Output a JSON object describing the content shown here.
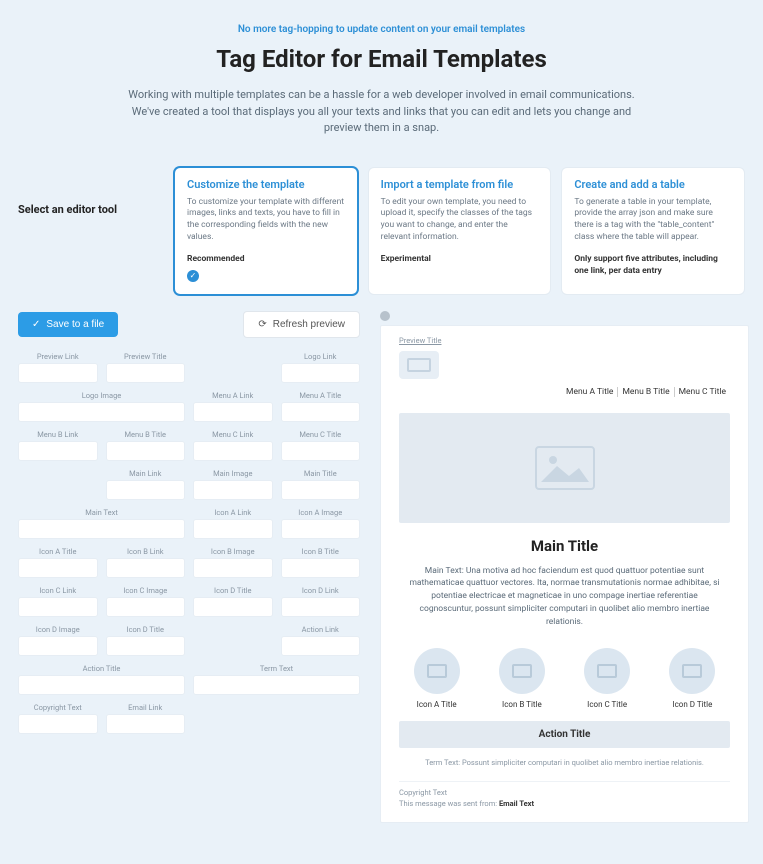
{
  "hero": {
    "eyebrow": "No more tag-hopping to update content on your email templates",
    "title": "Tag Editor for Email Templates",
    "sub": "Working with multiple templates can be a hassle for a web developer involved in email communications. We've created a tool that displays you all your texts and links that you can edit and lets you change and preview them in a snap."
  },
  "select_label": "Select an editor tool",
  "cards": [
    {
      "title": "Customize the template",
      "desc": "To customize your template with different images, links and texts, you have to fill in the corresponding fields with the new values.",
      "tag": "Recommended",
      "selected": true,
      "showCheck": true
    },
    {
      "title": "Import a template from file",
      "desc": "To edit your own template, you need to upload it, specify the classes of the tags you want to change, and enter the relevant information.",
      "tag": "Experimental",
      "selected": false,
      "showCheck": false
    },
    {
      "title": "Create and add a table",
      "desc": "To generate a table in your template, provide the array json and make sure there is a tag with the \"table_content\" class where the table will appear.",
      "note": "Only support five attributes, including one link, per data entry",
      "selected": false,
      "showCheck": false
    }
  ],
  "toolbar": {
    "save": "Save to a file",
    "refresh": "Refresh preview"
  },
  "fields": [
    {
      "label": "Preview Link",
      "span": 1
    },
    {
      "label": "Preview Title",
      "span": 1
    },
    {
      "label": "",
      "span": 1,
      "empty": true
    },
    {
      "label": "Logo Link",
      "span": 1
    },
    {
      "label": "Logo Image",
      "span": 2
    },
    {
      "label": "Menu A Link",
      "span": 1
    },
    {
      "label": "Menu A Title",
      "span": 1
    },
    {
      "label": "Menu B Link",
      "span": 1
    },
    {
      "label": "Menu B Title",
      "span": 1
    },
    {
      "label": "Menu C Link",
      "span": 1
    },
    {
      "label": "Menu C Title",
      "span": 1
    },
    {
      "label": "",
      "span": 1,
      "empty": true
    },
    {
      "label": "Main Link",
      "span": 1
    },
    {
      "label": "Main Image",
      "span": 1
    },
    {
      "label": "Main Title",
      "span": 1
    },
    {
      "label": "Main Text",
      "span": 2
    },
    {
      "label": "Icon A Link",
      "span": 1
    },
    {
      "label": "Icon A Image",
      "span": 1
    },
    {
      "label": "Icon A Title",
      "span": 1
    },
    {
      "label": "Icon B Link",
      "span": 1
    },
    {
      "label": "Icon B Image",
      "span": 1
    },
    {
      "label": "Icon B Title",
      "span": 1
    },
    {
      "label": "Icon C Link",
      "span": 1
    },
    {
      "label": "Icon C Image",
      "span": 1
    },
    {
      "label": "Icon D Title",
      "span": 1
    },
    {
      "label": "Icon D Link",
      "span": 1
    },
    {
      "label": "Icon D Image",
      "span": 1
    },
    {
      "label": "Icon D Title",
      "span": 1
    },
    {
      "label": "",
      "span": 1,
      "empty": true
    },
    {
      "label": "Action Link",
      "span": 1
    },
    {
      "label": "Action Title",
      "span": 2
    },
    {
      "label": "Term Text",
      "span": 2
    },
    {
      "label": "Copyright Text",
      "span": 1
    },
    {
      "label": "Email Link",
      "span": 1
    }
  ],
  "preview": {
    "top_link": "Preview Title",
    "menu": [
      "Menu A Title",
      "Menu B Title",
      "Menu C Title"
    ],
    "main_title": "Main Title",
    "main_text": "Main Text: Una motiva ad hoc faciendum est quod quattuor potentiae sunt mathematicae quattuor vectores. Ita, normae transmutationis normae adhibitae, si potentiae electricae et magneticae in uno compage inertiae referentiae cognoscuntur, possunt simpliciter computari in quolibet alio membro inertiae relationis.",
    "icons": [
      "Icon A Title",
      "Icon B Title",
      "Icon C Title",
      "Icon D Title"
    ],
    "action": "Action Title",
    "term": "Term Text: Possunt simpliciter computari in quolibet alio membro inertiae relationis.",
    "copyright": "Copyright Text",
    "sent_prefix": "This message was sent from: ",
    "sent_link": "Email Text"
  }
}
